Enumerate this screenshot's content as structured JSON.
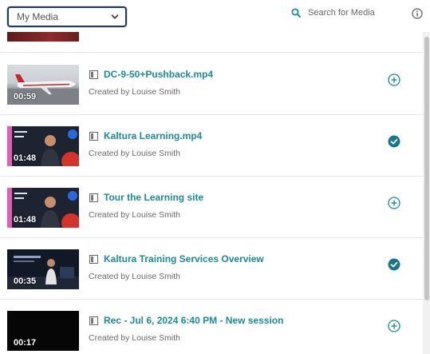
{
  "header": {
    "filter_select_value": "My Media",
    "search_placeholder": "Search for Media"
  },
  "media_items": [
    {
      "title": "DC-9-50+Pushback.mp4",
      "creator": "Created by Louise Smith",
      "duration": "00:59",
      "selected": false
    },
    {
      "title": "Kaltura Learning.mp4",
      "creator": "Created by Louise Smith",
      "duration": "01:48",
      "selected": true
    },
    {
      "title": "Tour the Learning site",
      "creator": "Created by Louise Smith",
      "duration": "01:48",
      "selected": false
    },
    {
      "title": "Kaltura Training Services Overview",
      "creator": "Created by Louise Smith",
      "duration": "00:35",
      "selected": true
    },
    {
      "title": "Rec - Jul 6, 2024 6:40 PM - New session",
      "creator": "Created by Louise Smith",
      "duration": "00:17",
      "selected": false
    }
  ],
  "colors": {
    "accent": "#1b8a9c",
    "selected_check": "#17778a",
    "select_border": "#1f3a5c"
  },
  "icons": {
    "search": "search-icon",
    "info": "info-icon",
    "media_type": "video-type-icon",
    "add": "add-circle-icon",
    "selected": "check-circle-icon"
  }
}
